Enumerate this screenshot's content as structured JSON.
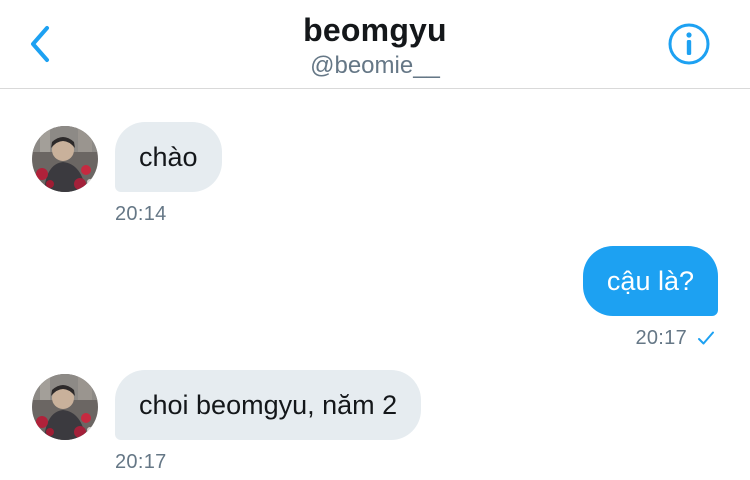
{
  "header": {
    "title": "beomgyu",
    "handle": "@beomie__",
    "back_icon": "chevron-left-icon",
    "info_icon": "info-circle-icon",
    "accent_color": "#1da1f2"
  },
  "messages": [
    {
      "direction": "incoming",
      "text": "chào",
      "time": "20:14"
    },
    {
      "direction": "outgoing",
      "text": "cậu là?",
      "time": "20:17",
      "status_icon": "checkmark-icon"
    },
    {
      "direction": "incoming",
      "text": "choi beomgyu, năm 2",
      "time": "20:17"
    }
  ],
  "colors": {
    "incoming_bubble": "#e6ecf0",
    "outgoing_bubble": "#1da1f2",
    "secondary_text": "#657786"
  }
}
